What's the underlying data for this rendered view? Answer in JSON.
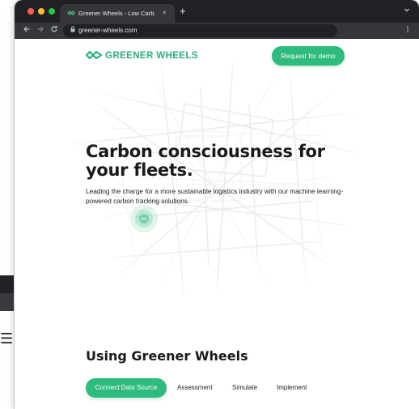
{
  "browser": {
    "tab_title": "Greener Wheels - Low Carbon",
    "tab_close": "×",
    "new_tab": "+",
    "url": "greener-wheels.com",
    "icons": {
      "back": "arrow-left-icon",
      "forward": "arrow-right-icon",
      "reload": "reload-icon",
      "lock": "lock-icon",
      "menu": "kebab-menu-icon",
      "tab_list": "chevron-down-icon"
    }
  },
  "header": {
    "logo_text": "GREENER WHEELS",
    "cta_label": "Request for demo"
  },
  "hero": {
    "title": "Carbon consciousness for your fleets.",
    "subtitle": "Leading the charge for a more sustainable logistics industry with our machine learning-powered carbon tracking solutions."
  },
  "section": {
    "title": "Using Greener Wheels",
    "tabs": [
      {
        "label": "Connect Data Source",
        "active": true
      },
      {
        "label": "Assessment",
        "active": false
      },
      {
        "label": "Simulate",
        "active": false
      },
      {
        "label": "Implement",
        "active": false
      }
    ]
  },
  "background_window": {
    "menu_glyph": "☰"
  },
  "colors": {
    "brand_green": "#2fbb7e",
    "logo_green": "#28b27a",
    "chrome_dark": "#202124",
    "chrome_toolbar": "#35363a"
  }
}
